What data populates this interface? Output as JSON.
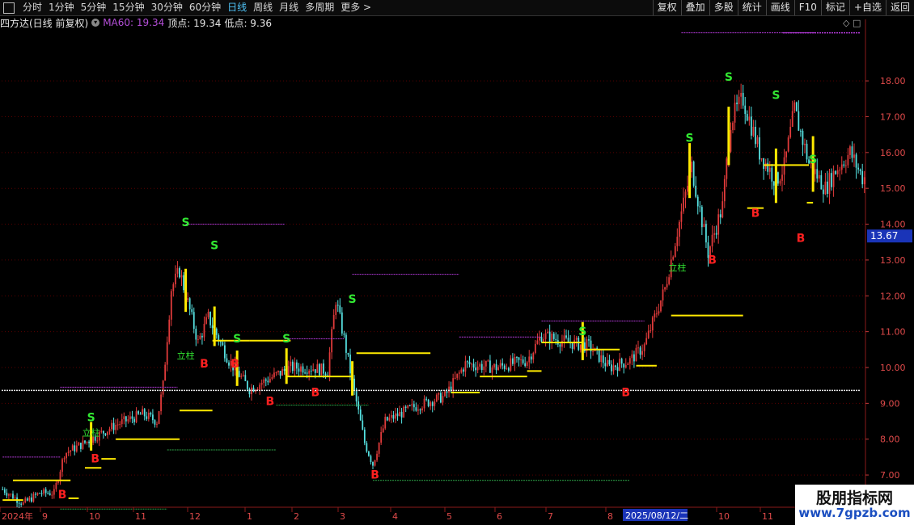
{
  "toolbar": {
    "periods": [
      "分时",
      "1分钟",
      "5分钟",
      "15分钟",
      "30分钟",
      "60分钟",
      "日线",
      "周线",
      "月线",
      "多周期",
      "更多 >"
    ],
    "active_period": "日线",
    "right_buttons": [
      "复权",
      "叠加",
      "多股",
      "统计",
      "画线",
      "F10",
      "标记",
      "+自选",
      "返回"
    ]
  },
  "info": {
    "title": "四方达(日线 前复权)",
    "ma_label": "MA60: 19.34",
    "top_label": "顶点: 19.34",
    "low_label": "低点: 9.36"
  },
  "top_right_icons": "◇ □",
  "watermark": {
    "line1": "股朋指标网",
    "line2": "www.7gpzb.com"
  },
  "colors": {
    "bg": "#000000",
    "grid": "#5a0000",
    "up": "#e23b3b",
    "down": "#56e1e1",
    "yellow": "#ffea00",
    "magenta": "#b53ad9",
    "green_text": "#32e832",
    "red_text": "#ff2020",
    "price_box": "#1a34b8"
  },
  "chart_data": {
    "type": "candlestick",
    "y_axis_labels": [
      "18.00",
      "17.00",
      "16.00",
      "15.00",
      "14.00",
      "13.00",
      "12.00",
      "11.00",
      "10.00",
      "9.00",
      "8.00",
      "7.00"
    ],
    "ylim": [
      6.1,
      19.4
    ],
    "current_price": "13.67",
    "highlight_date": "2025/08/12/二",
    "x_axis_labels": [
      "2024年",
      "9",
      "10",
      "11",
      "12",
      "1",
      "2",
      "3",
      "4",
      "5",
      "6",
      "7",
      "8",
      "10",
      "11"
    ],
    "white_line": 9.36,
    "top_line": 19.34,
    "waypoints": [
      [
        0,
        6.6
      ],
      [
        10,
        6.2
      ],
      [
        18,
        6.5
      ],
      [
        25,
        6.5
      ],
      [
        30,
        7.6
      ],
      [
        40,
        7.9
      ],
      [
        55,
        8.4
      ],
      [
        68,
        8.7
      ],
      [
        75,
        8.5
      ],
      [
        78,
        9.5
      ],
      [
        82,
        12.2
      ],
      [
        86,
        12.7
      ],
      [
        95,
        10.7
      ],
      [
        100,
        11.4
      ],
      [
        110,
        10.2
      ],
      [
        120,
        9.4
      ],
      [
        130,
        9.7
      ],
      [
        140,
        10.0
      ],
      [
        150,
        10.0
      ],
      [
        158,
        9.9
      ],
      [
        162,
        11.9
      ],
      [
        166,
        10.8
      ],
      [
        170,
        9.6
      ],
      [
        176,
        7.9
      ],
      [
        180,
        7.3
      ],
      [
        186,
        8.5
      ],
      [
        200,
        8.9
      ],
      [
        215,
        9.2
      ],
      [
        225,
        10.1
      ],
      [
        240,
        10.0
      ],
      [
        255,
        10.2
      ],
      [
        262,
        10.9
      ],
      [
        275,
        10.7
      ],
      [
        285,
        10.6
      ],
      [
        295,
        10.0
      ],
      [
        305,
        10.2
      ],
      [
        312,
        10.6
      ],
      [
        322,
        12.2
      ],
      [
        328,
        13.8
      ],
      [
        335,
        15.6
      ],
      [
        343,
        13.2
      ],
      [
        350,
        14.5
      ],
      [
        354,
        16.9
      ],
      [
        360,
        17.5
      ],
      [
        368,
        16.0
      ],
      [
        376,
        15.2
      ],
      [
        380,
        15.6
      ],
      [
        385,
        17.2
      ],
      [
        392,
        15.7
      ],
      [
        400,
        15.0
      ],
      [
        405,
        15.5
      ],
      [
        412,
        16.0
      ],
      [
        418,
        15.3
      ]
    ],
    "n_bars": 420,
    "signals": [
      {
        "label": "B",
        "i": 29,
        "price": 6.35,
        "kind": "buy"
      },
      {
        "label": "B",
        "i": 45,
        "price": 7.35,
        "kind": "buy"
      },
      {
        "label": "S",
        "i": 43,
        "price": 8.5,
        "kind": "sell"
      },
      {
        "label": "立柱",
        "i": 43,
        "price": 8.1,
        "kind": "pillar"
      },
      {
        "label": "S",
        "i": 89,
        "price": 13.95,
        "kind": "sell"
      },
      {
        "label": "S",
        "i": 103,
        "price": 13.3,
        "kind": "sell"
      },
      {
        "label": "立柱",
        "i": 89,
        "price": 10.25,
        "kind": "pillar"
      },
      {
        "label": "B",
        "i": 98,
        "price": 10.0,
        "kind": "buy"
      },
      {
        "label": "B",
        "i": 113,
        "price": 10.0,
        "kind": "buy"
      },
      {
        "label": "S",
        "i": 114,
        "price": 10.7,
        "kind": "sell"
      },
      {
        "label": "B",
        "i": 130,
        "price": 8.95,
        "kind": "buy"
      },
      {
        "label": "S",
        "i": 138,
        "price": 10.7,
        "kind": "sell"
      },
      {
        "label": "B",
        "i": 152,
        "price": 9.2,
        "kind": "buy"
      },
      {
        "label": "S",
        "i": 170,
        "price": 11.8,
        "kind": "sell"
      },
      {
        "label": "B",
        "i": 181,
        "price": 6.9,
        "kind": "buy"
      },
      {
        "label": "S",
        "i": 282,
        "price": 10.9,
        "kind": "sell"
      },
      {
        "label": "B",
        "i": 303,
        "price": 9.2,
        "kind": "buy"
      },
      {
        "label": "立柱",
        "i": 328,
        "price": 12.7,
        "kind": "pillar"
      },
      {
        "label": "S",
        "i": 334,
        "price": 16.3,
        "kind": "sell"
      },
      {
        "label": "B",
        "i": 345,
        "price": 12.9,
        "kind": "buy"
      },
      {
        "label": "S",
        "i": 353,
        "price": 18.0,
        "kind": "sell"
      },
      {
        "label": "B",
        "i": 366,
        "price": 14.2,
        "kind": "buy"
      },
      {
        "label": "S",
        "i": 376,
        "price": 17.5,
        "kind": "sell"
      },
      {
        "label": "B",
        "i": 388,
        "price": 13.5,
        "kind": "buy"
      },
      {
        "label": "S",
        "i": 394,
        "price": 15.7,
        "kind": "sell"
      }
    ],
    "yellow_levels": [
      {
        "from": 5,
        "to": 33,
        "price": 6.85
      },
      {
        "from": 0,
        "to": 10,
        "price": 6.3
      },
      {
        "from": 32,
        "to": 37,
        "price": 6.35
      },
      {
        "from": 40,
        "to": 48,
        "price": 7.2
      },
      {
        "from": 48,
        "to": 55,
        "price": 7.45
      },
      {
        "from": 55,
        "to": 86,
        "price": 8.0
      },
      {
        "from": 86,
        "to": 102,
        "price": 8.8
      },
      {
        "from": 102,
        "to": 120,
        "price": 10.75
      },
      {
        "from": 120,
        "to": 140,
        "price": 10.75
      },
      {
        "from": 138,
        "to": 170,
        "price": 9.75
      },
      {
        "from": 172,
        "to": 208,
        "price": 10.4
      },
      {
        "from": 218,
        "to": 232,
        "price": 9.3
      },
      {
        "from": 232,
        "to": 255,
        "price": 9.75
      },
      {
        "from": 255,
        "to": 262,
        "price": 9.9
      },
      {
        "from": 262,
        "to": 282,
        "price": 10.7
      },
      {
        "from": 282,
        "to": 300,
        "price": 10.5
      },
      {
        "from": 308,
        "to": 318,
        "price": 10.05
      },
      {
        "from": 325,
        "to": 360,
        "price": 11.45
      },
      {
        "from": 362,
        "to": 370,
        "price": 14.45
      },
      {
        "from": 370,
        "to": 392,
        "price": 15.65
      },
      {
        "from": 391,
        "to": 394,
        "price": 14.6
      }
    ],
    "magenta_levels": [
      {
        "from": 0,
        "to": 28,
        "price": 7.5
      },
      {
        "from": 28,
        "to": 85,
        "price": 9.45
      },
      {
        "from": 89,
        "to": 137,
        "price": 14.0
      },
      {
        "from": 137,
        "to": 166,
        "price": 10.8
      },
      {
        "from": 170,
        "to": 222,
        "price": 12.6
      },
      {
        "from": 222,
        "to": 262,
        "price": 10.85
      },
      {
        "from": 262,
        "to": 312,
        "price": 11.3
      },
      {
        "from": 330,
        "to": 368,
        "price": 19.34
      },
      {
        "from": 368,
        "to": 395,
        "price": 19.34
      }
    ],
    "green_levels": [
      {
        "from": 28,
        "to": 80,
        "price": 6.05
      },
      {
        "from": 80,
        "to": 133,
        "price": 7.7
      },
      {
        "from": 133,
        "to": 178,
        "price": 8.95
      },
      {
        "from": 180,
        "to": 305,
        "price": 6.85
      }
    ]
  }
}
